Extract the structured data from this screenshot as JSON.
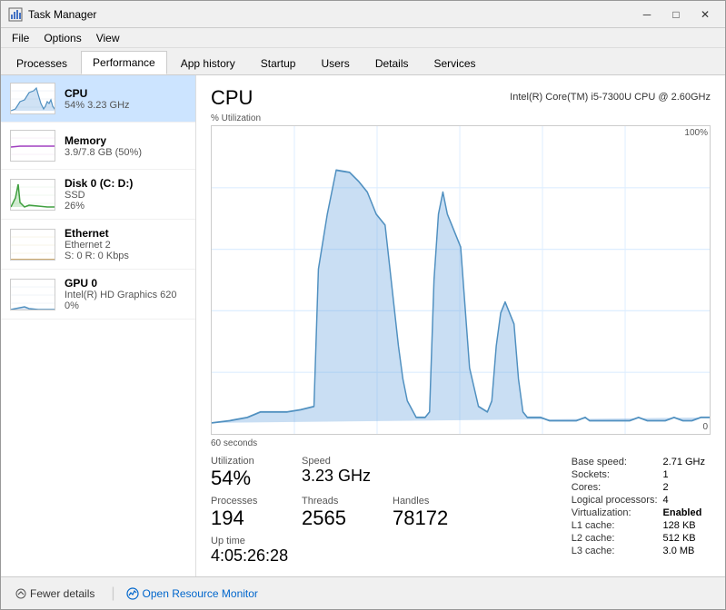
{
  "window": {
    "title": "Task Manager",
    "controls": {
      "minimize": "─",
      "maximize": "□",
      "close": "✕"
    }
  },
  "menu": {
    "items": [
      "File",
      "Options",
      "View"
    ]
  },
  "tabs": {
    "items": [
      "Processes",
      "Performance",
      "App history",
      "Startup",
      "Users",
      "Details",
      "Services"
    ],
    "active": "Performance"
  },
  "sidebar": {
    "items": [
      {
        "name": "CPU",
        "sub1": "54% 3.23 GHz",
        "sub2": "",
        "type": "cpu"
      },
      {
        "name": "Memory",
        "sub1": "3.9/7.8 GB (50%)",
        "sub2": "",
        "type": "memory"
      },
      {
        "name": "Disk 0 (C: D:)",
        "sub1": "SSD",
        "sub2": "26%",
        "type": "disk"
      },
      {
        "name": "Ethernet",
        "sub1": "Ethernet 2",
        "sub2": "S: 0  R: 0 Kbps",
        "type": "ethernet"
      },
      {
        "name": "GPU 0",
        "sub1": "Intel(R) HD Graphics 620",
        "sub2": "0%",
        "type": "gpu"
      }
    ]
  },
  "main": {
    "title": "CPU",
    "model": "Intel(R) Core(TM) i5-7300U CPU @ 2.60GHz",
    "chart_label": "% Utilization",
    "chart_max": "100%",
    "chart_time_left": "60 seconds",
    "chart_time_right": "0",
    "stats": {
      "utilization_label": "Utilization",
      "utilization_value": "54%",
      "speed_label": "Speed",
      "speed_value": "3.23 GHz",
      "processes_label": "Processes",
      "processes_value": "194",
      "threads_label": "Threads",
      "threads_value": "2565",
      "handles_label": "Handles",
      "handles_value": "78172",
      "uptime_label": "Up time",
      "uptime_value": "4:05:26:28"
    },
    "right_stats": {
      "base_speed_label": "Base speed:",
      "base_speed_value": "2.71 GHz",
      "sockets_label": "Sockets:",
      "sockets_value": "1",
      "cores_label": "Cores:",
      "cores_value": "2",
      "logical_label": "Logical processors:",
      "logical_value": "4",
      "virt_label": "Virtualization:",
      "virt_value": "Enabled",
      "l1_label": "L1 cache:",
      "l1_value": "128 KB",
      "l2_label": "L2 cache:",
      "l2_value": "512 KB",
      "l3_label": "L3 cache:",
      "l3_value": "3.0 MB"
    }
  },
  "bottom": {
    "fewer_details": "Fewer details",
    "open_monitor": "Open Resource Monitor"
  }
}
